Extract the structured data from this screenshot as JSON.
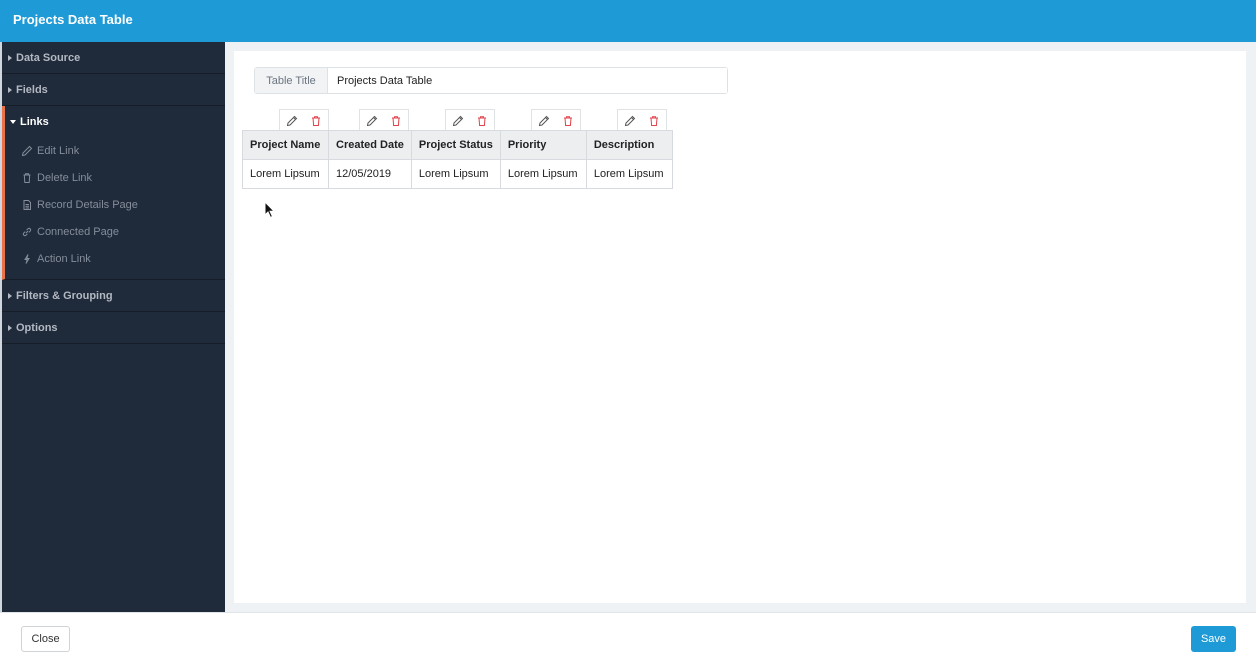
{
  "header": {
    "title": "Projects Data Table"
  },
  "sidebar": {
    "sections": [
      {
        "label": "Data Source"
      },
      {
        "label": "Fields"
      },
      {
        "label": "Links",
        "open": true,
        "items": [
          {
            "label": "Edit Link",
            "icon": "pencil-icon"
          },
          {
            "label": "Delete Link",
            "icon": "trash-icon"
          },
          {
            "label": "Record Details Page",
            "icon": "document-icon"
          },
          {
            "label": "Connected Page",
            "icon": "link-icon"
          },
          {
            "label": "Action Link",
            "icon": "lightning-icon"
          }
        ]
      },
      {
        "label": "Filters & Grouping"
      },
      {
        "label": "Options"
      }
    ]
  },
  "main": {
    "title_label": "Table Title",
    "title_value": "Projects Data Table",
    "table": {
      "columns": [
        "Project Name",
        "Created Date",
        "Project Status",
        "Priority",
        "Description"
      ],
      "rows": [
        [
          "Lorem Lipsum",
          "12/05/2019",
          "Lorem Lipsum",
          "Lorem Lipsum",
          "Lorem Lipsum"
        ]
      ]
    }
  },
  "footer": {
    "close_label": "Close",
    "save_label": "Save"
  },
  "colors": {
    "header": "#1e9bd7",
    "sidebar": "#1f2a3b",
    "accent": "#e8734a",
    "delete": "#e0414a"
  }
}
